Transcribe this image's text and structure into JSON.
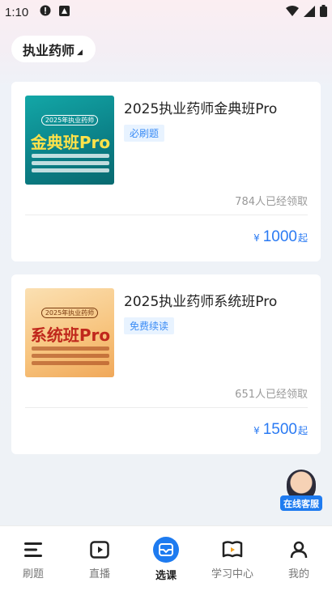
{
  "status_bar": {
    "time": "1:10"
  },
  "filter": {
    "label": "执业药师"
  },
  "courses": [
    {
      "title": "2025执业药师金典班Pro",
      "badge": "必刷题",
      "claimed": "784人已经领取",
      "currency": "¥",
      "price": "1000",
      "price_suffix": "起",
      "thumb": {
        "tag": "2025年执业药师",
        "big": "金典班Pro"
      }
    },
    {
      "title": "2025执业药师系统班Pro",
      "badge": "免费续读",
      "claimed": "651人已经领取",
      "currency": "¥",
      "price": "1500",
      "price_suffix": "起",
      "thumb": {
        "tag": "2025年执业药师",
        "big": "系统班Pro"
      }
    }
  ],
  "service": {
    "label": "在线客服"
  },
  "tabs": [
    {
      "label": "刷题",
      "icon": "menu-icon",
      "active": false
    },
    {
      "label": "直播",
      "icon": "play-icon",
      "active": false
    },
    {
      "label": "选课",
      "icon": "mail-icon",
      "active": true
    },
    {
      "label": "学习中心",
      "icon": "book-play-icon",
      "active": false
    },
    {
      "label": "我的",
      "icon": "user-icon",
      "active": false
    }
  ],
  "colors": {
    "accent": "#1e7bf0",
    "price": "#2a7af3",
    "badge_bg": "#e8f3ff"
  }
}
